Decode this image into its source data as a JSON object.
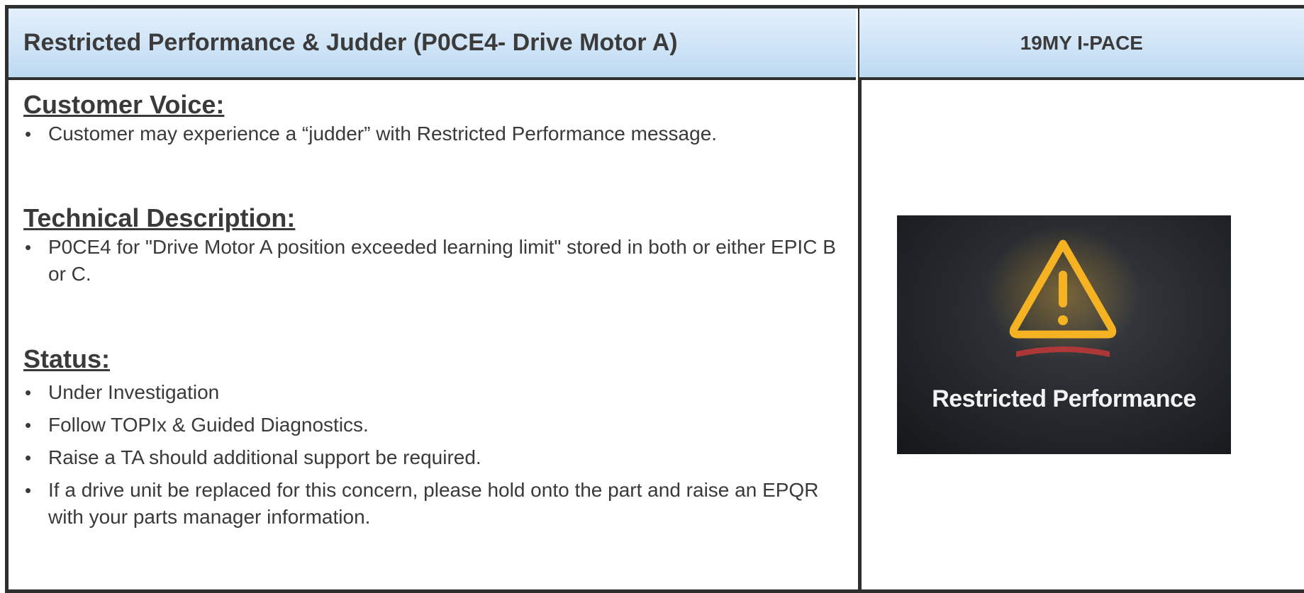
{
  "header": {
    "title": "Restricted Performance & Judder (P0CE4- Drive Motor A)",
    "model": "19MY I-PACE"
  },
  "customer_voice": {
    "heading": "Customer Voice:",
    "items": [
      "Customer may experience a “judder” with Restricted Performance message."
    ]
  },
  "technical_description": {
    "heading": "Technical Description:",
    "items": [
      "P0CE4 for \"Drive Motor A position exceeded learning limit\" stored in both or either EPIC B or C."
    ]
  },
  "status": {
    "heading": "Status:",
    "items": [
      "Under Investigation",
      "Follow TOPIx & Guided Diagnostics.",
      "Raise a TA should additional support be required.",
      "If a drive unit be replaced for this concern, please hold onto the part and raise an EPQR with your parts manager information."
    ]
  },
  "photo": {
    "caption": "Restricted Performance",
    "icon": "warning-triangle-icon",
    "icon_color": "#f5b324"
  }
}
